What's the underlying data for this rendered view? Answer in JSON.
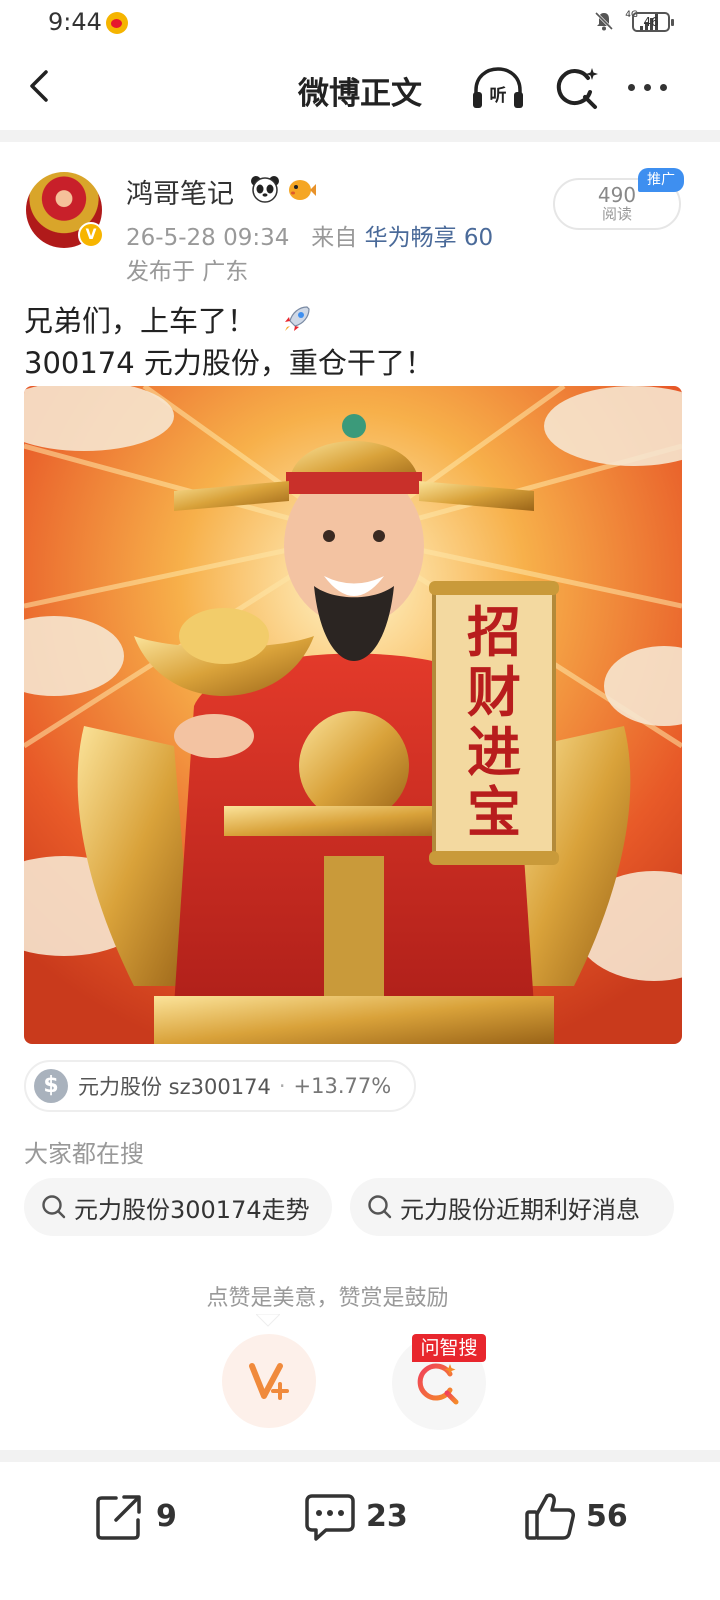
{
  "status_bar": {
    "time": "9:44",
    "network": "4G",
    "battery": "46"
  },
  "nav": {
    "title": "微博正文",
    "listen_label": "听"
  },
  "author": {
    "name": "鸿哥笔记",
    "date": "26-5-28 09:34",
    "source_prefix": "来自",
    "device": "华为畅享 60",
    "location": "发布于 广东",
    "views_count": "490",
    "views_label": "阅读",
    "promo_badge": "推广"
  },
  "post": {
    "line1": "兄弟们，上车了！",
    "line2": "300174 元力股份，重仓干了！",
    "image_scroll_text": [
      "招",
      "财",
      "进",
      "宝"
    ]
  },
  "stock_chip": {
    "name": "元力股份 sz300174",
    "separator": "·",
    "change": "+13.77%"
  },
  "search": {
    "title": "大家都在搜",
    "items": [
      "元力股份300174走势",
      "元力股份近期利好消息"
    ]
  },
  "reward": {
    "tip": "点赞是美意，赞赏是鼓励",
    "zhisou_tag": "问智搜"
  },
  "actions": {
    "share_count": "9",
    "comment_count": "23",
    "like_count": "56"
  },
  "colors": {
    "link_blue": "#4a6a99",
    "promo_blue": "#3e8ff0",
    "reward_orange": "#f08a3c",
    "zhisou_red": "#e8262d"
  }
}
